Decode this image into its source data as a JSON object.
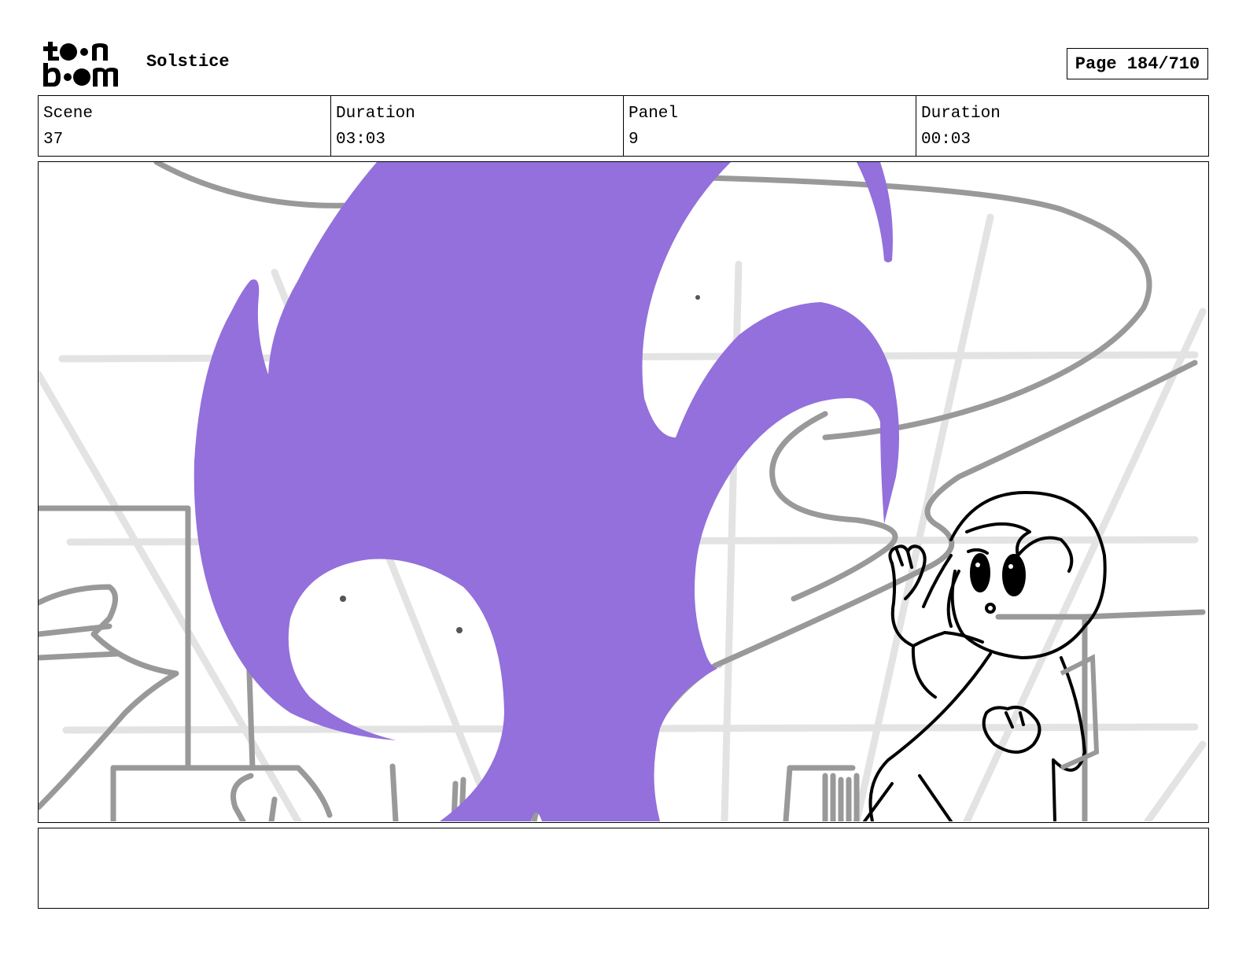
{
  "header": {
    "logo_text": "toonboom",
    "project_title": "Solstice",
    "page_indicator": "Page 184/710"
  },
  "info": {
    "scene_label": "Scene",
    "scene_value": "37",
    "scene_duration_label": "Duration",
    "scene_duration_value": "03:03",
    "panel_label": "Panel",
    "panel_value": "9",
    "panel_duration_label": "Duration",
    "panel_duration_value": "00:03"
  },
  "panel_image": {
    "accent_color": "#9370DB",
    "line_color": "#000000",
    "background_line_color": "#999999"
  },
  "caption": {
    "text": ""
  }
}
